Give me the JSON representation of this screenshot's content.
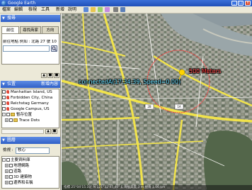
{
  "window": {
    "title": "Google Earth"
  },
  "menu": {
    "items": [
      "檔案",
      "編輯",
      "檢視",
      "工具",
      "新增",
      "說明"
    ]
  },
  "search_panel": {
    "title": "搜尋",
    "tabs": [
      "前往",
      "尋找商家",
      "方向"
    ],
    "fly_to_label": "前往地點 例如 : 北路 27 號 10 1",
    "query_value": ""
  },
  "places_panel": {
    "title": "位置",
    "add_label": "新增內容",
    "items": [
      {
        "label": "Manhattan Island, US",
        "checked": true,
        "type": "pin"
      },
      {
        "label": "Forbidden City, China",
        "checked": true,
        "type": "pin"
      },
      {
        "label": "Reichstag Germany",
        "checked": true,
        "type": "pin"
      },
      {
        "label": "Google Campus, US",
        "checked": true,
        "type": "pin"
      },
      {
        "label": "暫存位置",
        "checked": true,
        "type": "folder"
      },
      {
        "label": "Trace Dots",
        "checked": true,
        "type": "folder"
      }
    ]
  },
  "layers_panel": {
    "title": "圖層",
    "view_label": "檢視 :",
    "view_value": "核心",
    "items": [
      {
        "label": "主要資料庫",
        "checked": true
      },
      {
        "label": "地理網路",
        "checked": false
      },
      {
        "label": "道路",
        "checked": true
      },
      {
        "label": "3D 建築物",
        "checked": false
      },
      {
        "label": "邊界和名稱",
        "checked": true
      }
    ]
  },
  "map": {
    "placemark_label": "connectedA(17:34:39, Speed=0.00)",
    "range_label": "500 Meters",
    "road_shields": [
      "2B",
      "1A"
    ],
    "status_text": "指標 25°04'15.10\" N 121°32'47.40\" E  海拔高度 3 m   視角 1.06 km",
    "colors": {
      "label_cyan": "#66e0ff",
      "range_red": "#ff3b3b",
      "pin_yellow": "#ffd400"
    }
  }
}
